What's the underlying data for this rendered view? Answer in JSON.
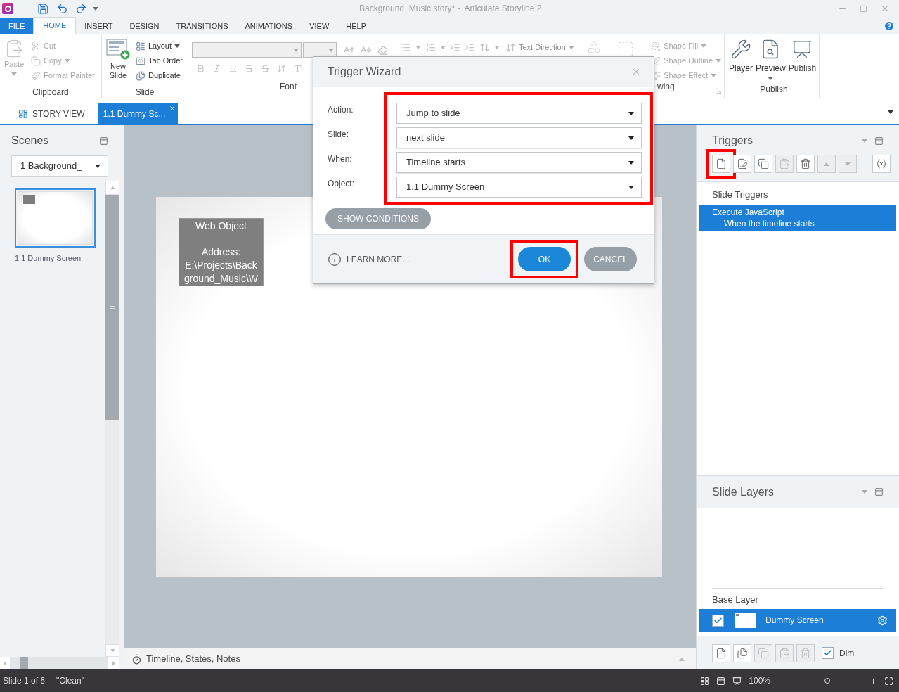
{
  "window": {
    "title": "Background_Music.story* -  Articulate Storyline 2"
  },
  "ribbon_tabs": [
    {
      "label": "FILE",
      "kind": "file",
      "selected": false
    },
    {
      "label": "HOME",
      "kind": "tab",
      "selected": true
    },
    {
      "label": "INSERT",
      "kind": "tab",
      "selected": false
    },
    {
      "label": "DESIGN",
      "kind": "tab",
      "selected": false
    },
    {
      "label": "TRANSITIONS",
      "kind": "tab",
      "selected": false
    },
    {
      "label": "ANIMATIONS",
      "kind": "tab",
      "selected": false
    },
    {
      "label": "VIEW",
      "kind": "tab",
      "selected": false
    },
    {
      "label": "HELP",
      "kind": "tab",
      "selected": false
    }
  ],
  "ribbon": {
    "clipboard": {
      "label": "Clipboard",
      "paste": {
        "label": "Paste",
        "disabled": true
      },
      "items": [
        {
          "label": "Cut",
          "kind": "cut",
          "dropdown": false,
          "disabled": true
        },
        {
          "label": "Copy",
          "kind": "copy",
          "dropdown": true,
          "disabled": true
        },
        {
          "label": "Format Painter",
          "kind": "painter",
          "dropdown": false,
          "disabled": true
        }
      ]
    },
    "slide": {
      "label": "Slide",
      "new_slide": [
        "New",
        "Slide"
      ],
      "items": [
        {
          "label": "Layout",
          "kind": "layout",
          "dropdown": true,
          "disabled": false
        },
        {
          "label": "Tab Order",
          "kind": "taborder",
          "dropdown": false,
          "disabled": false
        },
        {
          "label": "Duplicate",
          "kind": "duplicate",
          "dropdown": false,
          "disabled": false
        }
      ]
    },
    "font": {
      "label": "Font"
    },
    "paragraph": {
      "text_direction": {
        "label": "Text Direction",
        "disabled": true
      }
    },
    "drawing": {
      "label": "wing",
      "items": [
        {
          "label": "Shape Fill",
          "kind": "fill",
          "dropdown": true,
          "disabled": true
        },
        {
          "label": "Shape Outline",
          "kind": "outline",
          "dropdown": true,
          "disabled": true
        },
        {
          "label": "Shape Effect",
          "kind": "effect",
          "dropdown": true,
          "disabled": true
        }
      ]
    },
    "publish": {
      "label": "Publish",
      "items": [
        {
          "label": "Player",
          "kind": "player",
          "dropdown": false
        },
        {
          "label": "Preview",
          "kind": "preview",
          "dropdown": true
        },
        {
          "label": "Publish",
          "kind": "publish",
          "dropdown": false
        }
      ]
    }
  },
  "document_tabs": [
    {
      "label": "STORY VIEW",
      "kind": "story",
      "selected": false
    },
    {
      "label": "1.1 Dummy Sc...",
      "kind": "slide",
      "selected": true
    }
  ],
  "scenes_panel": {
    "title": "Scenes",
    "scene_select": {
      "value": "1 Background_"
    },
    "slides": [
      {
        "label": "1.1 Dummy Screen",
        "selected": true
      }
    ]
  },
  "canvas": {
    "web_object": {
      "title": "Web Object",
      "lines": [
        "Address:",
        "E:\\Projects\\Back",
        "ground_Music\\W"
      ]
    }
  },
  "timeline_bar": {
    "label": "Timeline, States, Notes"
  },
  "triggers_panel": {
    "title": "Triggers",
    "toolbar": [
      {
        "kind": "new",
        "highlighted": true,
        "disabled": false
      },
      {
        "kind": "edit",
        "highlighted": false,
        "disabled": false
      },
      {
        "kind": "copy",
        "highlighted": false,
        "disabled": false
      },
      {
        "kind": "paste",
        "highlighted": false,
        "disabled": true
      },
      {
        "kind": "delete",
        "highlighted": false,
        "disabled": false
      },
      {
        "kind": "up",
        "highlighted": false,
        "disabled": true
      },
      {
        "kind": "down",
        "highlighted": false,
        "disabled": true
      },
      {
        "kind": "variables",
        "highlighted": false,
        "disabled": false
      }
    ],
    "section": "Slide Triggers",
    "triggers": [
      {
        "action": "Execute JavaScript",
        "when": "When the timeline starts",
        "selected": true
      }
    ]
  },
  "layers_panel": {
    "title": "Slide Layers",
    "base_layer": "Base Layer",
    "layers": [
      {
        "name": "Dummy Screen",
        "visible": true,
        "selected": true
      }
    ],
    "toolbar": [
      {
        "kind": "new",
        "disabled": false
      },
      {
        "kind": "duplicate",
        "disabled": false
      },
      {
        "kind": "copy",
        "disabled": true
      },
      {
        "kind": "paste",
        "disabled": true
      },
      {
        "kind": "delete",
        "disabled": true
      }
    ],
    "dim": {
      "label": "Dim",
      "checked": true
    }
  },
  "dialog": {
    "title": "Trigger Wizard",
    "fields_highlighted": true,
    "fields": [
      {
        "label": "Action:",
        "value": "Jump to slide"
      },
      {
        "label": "Slide:",
        "value": "next slide"
      },
      {
        "label": "When:",
        "value": "Timeline starts"
      },
      {
        "label": "Object:",
        "value": "1.1 Dummy Screen"
      }
    ],
    "show_conditions": "SHOW CONDITIONS",
    "learn_more": "LEARN MORE...",
    "buttons": [
      {
        "label": "OK",
        "kind": "primary",
        "highlighted": true
      },
      {
        "label": "CANCEL",
        "kind": "secondary",
        "highlighted": false
      }
    ]
  },
  "status_bar": {
    "slide": "Slide 1 of 6",
    "state": "\"Clean\"",
    "zoom": "100%",
    "zoom_slider": {
      "level": 0.5
    }
  }
}
